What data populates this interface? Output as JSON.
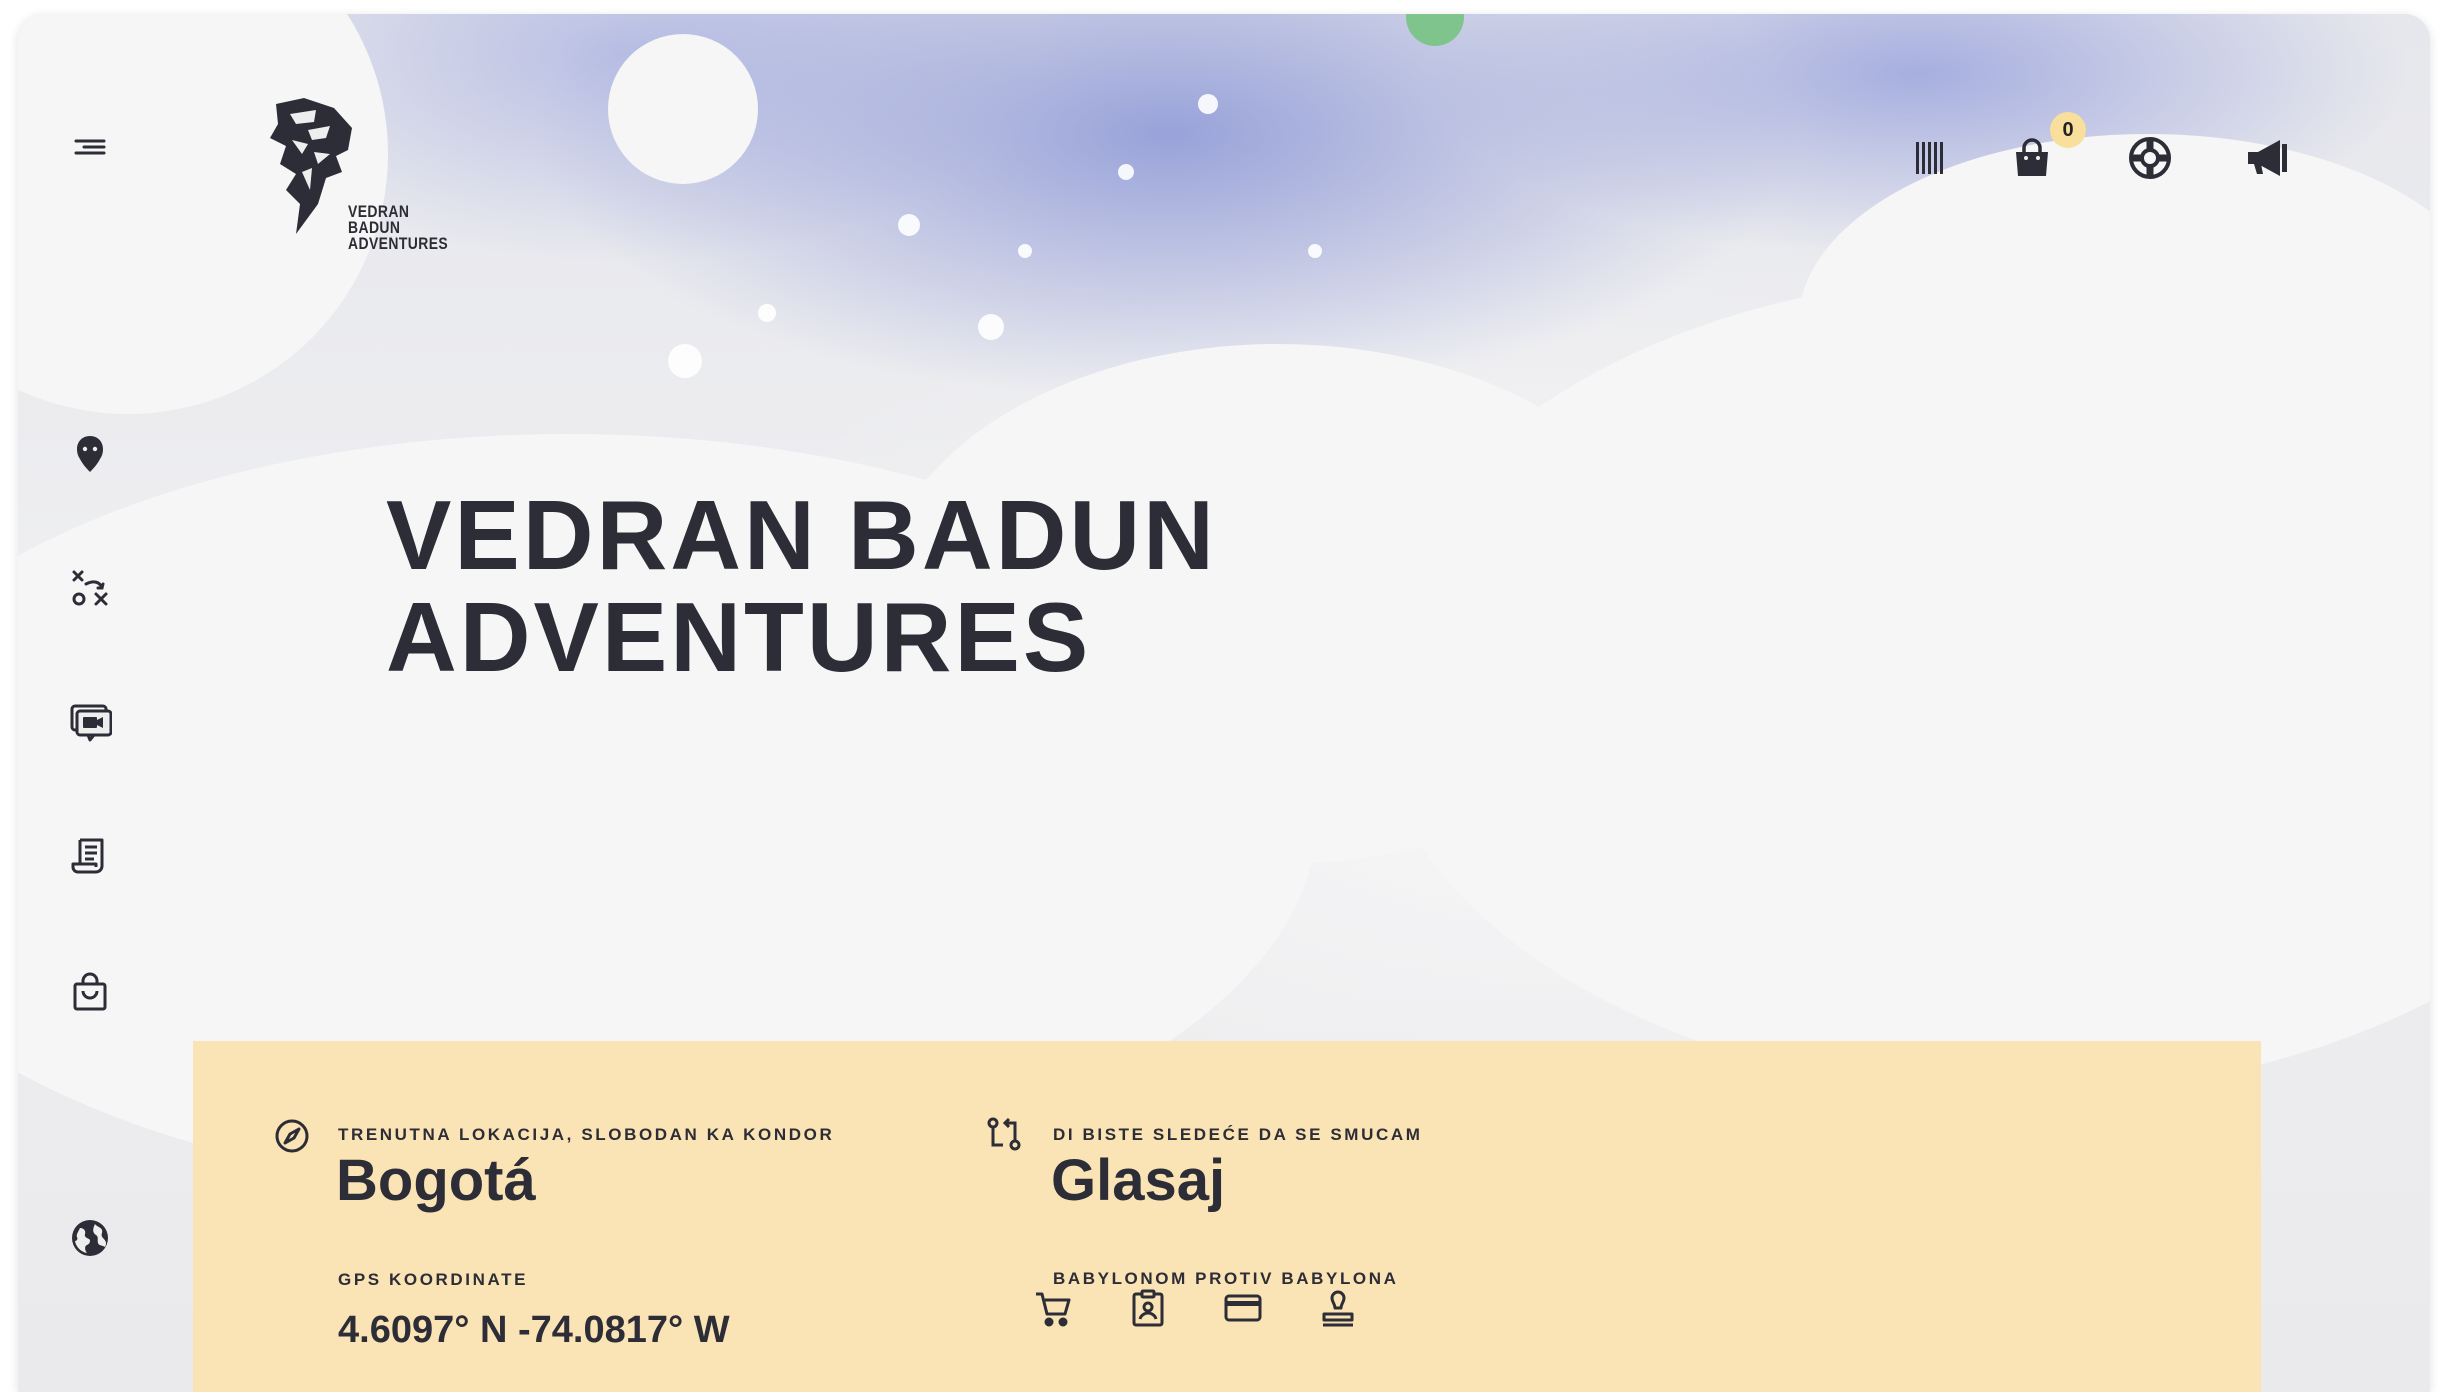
{
  "brand": {
    "logo_text": "VEDRAN\nBADUN\nADVENTURES"
  },
  "sidebar": {
    "menu_icon": "menu-icon",
    "items": [
      {
        "icon": "bearded-face-icon"
      },
      {
        "icon": "strategy-icon"
      },
      {
        "icon": "video-chat-icon"
      },
      {
        "icon": "scroll-document-icon"
      },
      {
        "icon": "shopping-bag-icon"
      },
      {
        "icon": "globe-icon"
      }
    ]
  },
  "topbar": {
    "icons": [
      "barcode-icon",
      "bag-icon",
      "lifebuoy-icon",
      "megaphone-icon"
    ],
    "cart_count": "0"
  },
  "hero": {
    "line1": "VEDRAN BADUN",
    "line2": "ADVENTURES"
  },
  "info": {
    "location_label": "TRENUTNA LOKACIJA, SLOBODAN KA KONDOR",
    "location_value": "Bogotá",
    "gps_label": "GPS KOORDINATE",
    "gps_value": "4.6097° N -74.0817° W",
    "next_label": "DI BISTE SLEDEĆE DA SE SMUCAM",
    "next_value": "Glasaj",
    "babylon_label": "BABYLONOM PROTIV BABYLONA",
    "babylon_icons": [
      "cart-icon",
      "clipboard-badge-icon",
      "credit-card-icon",
      "stamp-icon"
    ]
  },
  "colors": {
    "panel": "#fae3b4",
    "text": "#2c2d36",
    "badge": "#f8df9c",
    "splash_blue": "#8b96d6"
  }
}
